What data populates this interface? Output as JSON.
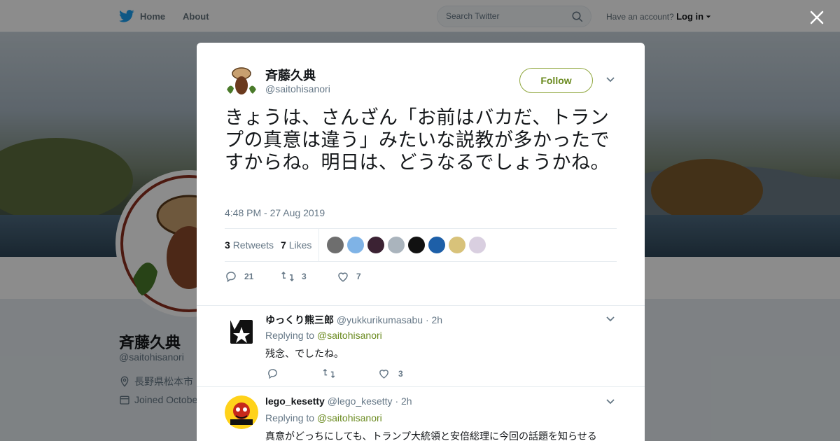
{
  "nav": {
    "home_label": "Home",
    "about_label": "About",
    "search_placeholder": "Search Twitter",
    "account_prompt": "Have an account?",
    "login_label": "Log in"
  },
  "background_profile": {
    "name": "斉藤久典",
    "handle": "@saitohisanori",
    "location": "長野県松本市",
    "joined": "Joined Octobe"
  },
  "tweet": {
    "author_name": "斉藤久典",
    "author_handle": "@saitohisanori",
    "follow_label": "Follow",
    "text": "きょうは、さんざん「お前はバカだ、トランプの真意は違う」みたいな説教が多かったですからね。明日は、どうなるでしょうかね。",
    "timestamp": "4:48 PM - 27 Aug 2019",
    "retweets_count": "3",
    "retweets_label": "Retweets",
    "likes_count": "7",
    "likes_label": "Likes",
    "reply_count": "21",
    "retweet_count": "3",
    "like_count": "7"
  },
  "likers": [
    {
      "color": "#6e6e6e"
    },
    {
      "color": "#7fb3e6"
    },
    {
      "color": "#3b2233"
    },
    {
      "color": "#aab4bd"
    },
    {
      "color": "#111111"
    },
    {
      "color": "#1d5fa8"
    },
    {
      "color": "#d8c27a"
    },
    {
      "color": "#d9cfe0"
    }
  ],
  "replies": [
    {
      "name": "ゆっくり熊三郎",
      "handle": "@yukkurikumasabu",
      "time": "· 2h",
      "replying_prefix": "Replying to",
      "replying_to": "@saitohisanori",
      "text": "残念、でしたね。",
      "like_count": "3"
    },
    {
      "name": "lego_kesetty",
      "handle": "@lego_kesetty",
      "time": "· 2h",
      "replying_prefix": "Replying to",
      "replying_to": "@saitohisanori",
      "text": "真意がどっちにしても、トランプ大統領と安倍総理に今回の話題を知らせる"
    }
  ],
  "colors": {
    "accent": "#6a8a1f",
    "twitter_blue": "#1da1f2",
    "like_pink": "#e0245e"
  }
}
